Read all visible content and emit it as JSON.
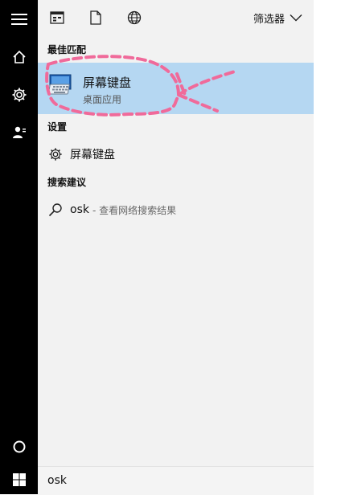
{
  "toolbar": {
    "icons": [
      "apps-icon",
      "document-icon",
      "web-icon"
    ],
    "filter_label": "筛选器"
  },
  "sections": {
    "best_match_title": "最佳匹配",
    "settings_title": "设置",
    "suggestions_title": "搜索建议"
  },
  "best_match": {
    "title": "屏幕键盘",
    "subtitle": "桌面应用"
  },
  "settings_item": {
    "label": "屏幕键盘"
  },
  "suggestion": {
    "query": "osk",
    "hint": "- 查看网络搜索结果"
  },
  "search": {
    "value": "osk"
  },
  "colors": {
    "rail": "#000000",
    "panel": "#f2f2f2",
    "highlight": "#b5d7f2",
    "annotation": "#f06a9a"
  }
}
